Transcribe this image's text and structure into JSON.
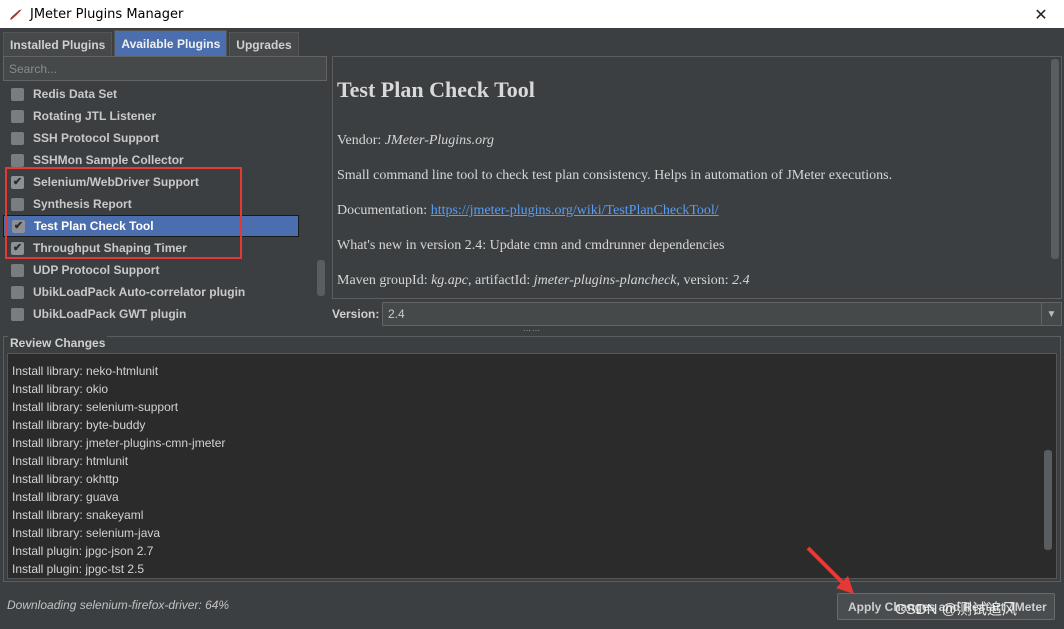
{
  "window": {
    "title": "JMeter Plugins Manager",
    "close_glyph": "✕"
  },
  "tabs": [
    {
      "label": "Installed Plugins"
    },
    {
      "label": "Available Plugins"
    },
    {
      "label": "Upgrades"
    }
  ],
  "search": {
    "placeholder": "Search..."
  },
  "plugins": [
    {
      "label": "Redis Data Set"
    },
    {
      "label": "Rotating JTL Listener"
    },
    {
      "label": "SSH Protocol Support"
    },
    {
      "label": "SSHMon Sample Collector"
    },
    {
      "label": "Selenium/WebDriver Support"
    },
    {
      "label": "Synthesis Report"
    },
    {
      "label": "Test Plan Check Tool"
    },
    {
      "label": "Throughput Shaping Timer"
    },
    {
      "label": "UDP Protocol Support"
    },
    {
      "label": "UbikLoadPack Auto-correlator plugin"
    },
    {
      "label": "UbikLoadPack GWT plugin"
    }
  ],
  "detail": {
    "title": "Test Plan Check Tool",
    "vendor_label": "Vendor:",
    "vendor": "JMeter-Plugins.org",
    "description": "Small command line tool to check test plan consistency. Helps in automation of JMeter executions.",
    "doc_label": "Documentation:",
    "doc_link": "https://jmeter-plugins.org/wiki/TestPlanCheckTool/",
    "whats_new": "What's new in version 2.4: Update cmn and cmdrunner dependencies",
    "maven_label": "Maven groupId:",
    "group_id": "kg.apc",
    "artifact_label": ", artifactId:",
    "artifact_id": "jmeter-plugins-plancheck",
    "version_label_inline": ", version:",
    "version_inline": "2.4"
  },
  "version": {
    "label": "Version:",
    "value": "2.4"
  },
  "review": {
    "title": "Review Changes",
    "lines": [
      "Install library: neko-htmlunit",
      "Install library: okio",
      "Install library: selenium-support",
      "Install library: byte-buddy",
      "Install library: jmeter-plugins-cmn-jmeter",
      "Install library: htmlunit",
      "Install library: okhttp",
      "Install library: guava",
      "Install library: snakeyaml",
      "Install library: selenium-java",
      "Install plugin: jpgc-json 2.7",
      "Install plugin: jpgc-tst 2.5"
    ]
  },
  "status": {
    "text": "Downloading selenium-firefox-driver: 64%"
  },
  "apply_button": {
    "label": "Apply Changes and Restart JMeter"
  },
  "watermark": {
    "text": "CSDN @测试追风"
  },
  "colors": {
    "accent": "#4b6eaf",
    "annotation_red": "#e53935"
  }
}
